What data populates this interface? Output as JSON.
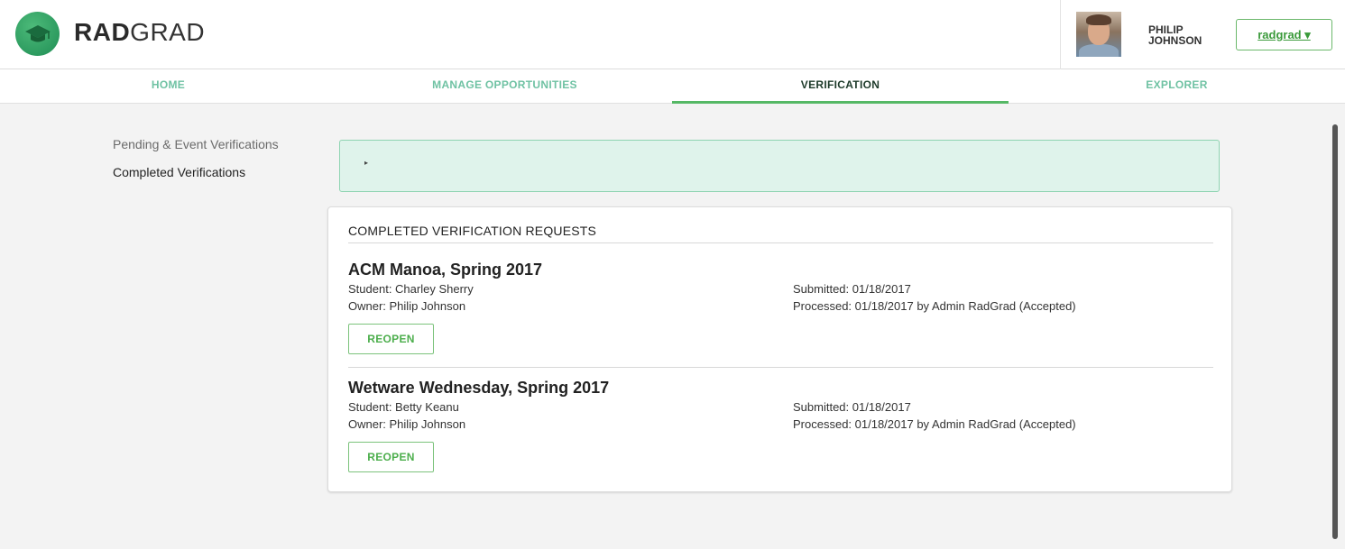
{
  "header": {
    "brand_bold": "RAD",
    "brand_light": "GRAD",
    "logo_icon": "graduation-cap-icon",
    "user": {
      "name_line1": "PHILIP",
      "name_line2": "JOHNSON"
    },
    "account_button": "radgrad ▾"
  },
  "nav": {
    "tabs": [
      {
        "label": "HOME",
        "active": false
      },
      {
        "label": "MANAGE OPPORTUNITIES",
        "active": false
      },
      {
        "label": "VERIFICATION",
        "active": true
      },
      {
        "label": "EXPLORER",
        "active": false
      }
    ]
  },
  "sidebar": {
    "items": [
      {
        "label": "Pending & Event Verifications",
        "current": false
      },
      {
        "label": "Completed Verifications",
        "current": true
      }
    ]
  },
  "accordion": {
    "caret": "▸"
  },
  "completed": {
    "title": "COMPLETED VERIFICATION REQUESTS",
    "requests": [
      {
        "name": "ACM Manoa, Spring 2017",
        "student": "Student: Charley Sherry",
        "owner": "Owner: Philip Johnson",
        "submitted": "Submitted: 01/18/2017",
        "processed": "Processed: 01/18/2017 by Admin RadGrad (Accepted)",
        "button": "REOPEN"
      },
      {
        "name": "Wetware Wednesday, Spring 2017",
        "student": "Student: Betty Keanu",
        "owner": "Owner: Philip Johnson",
        "submitted": "Submitted: 01/18/2017",
        "processed": "Processed: 01/18/2017 by Admin RadGrad (Accepted)",
        "button": "REOPEN"
      }
    ]
  },
  "colors": {
    "accent_green": "#55b865",
    "nav_inactive": "#6fc2a3",
    "accordion_bg": "#dff3eb"
  }
}
